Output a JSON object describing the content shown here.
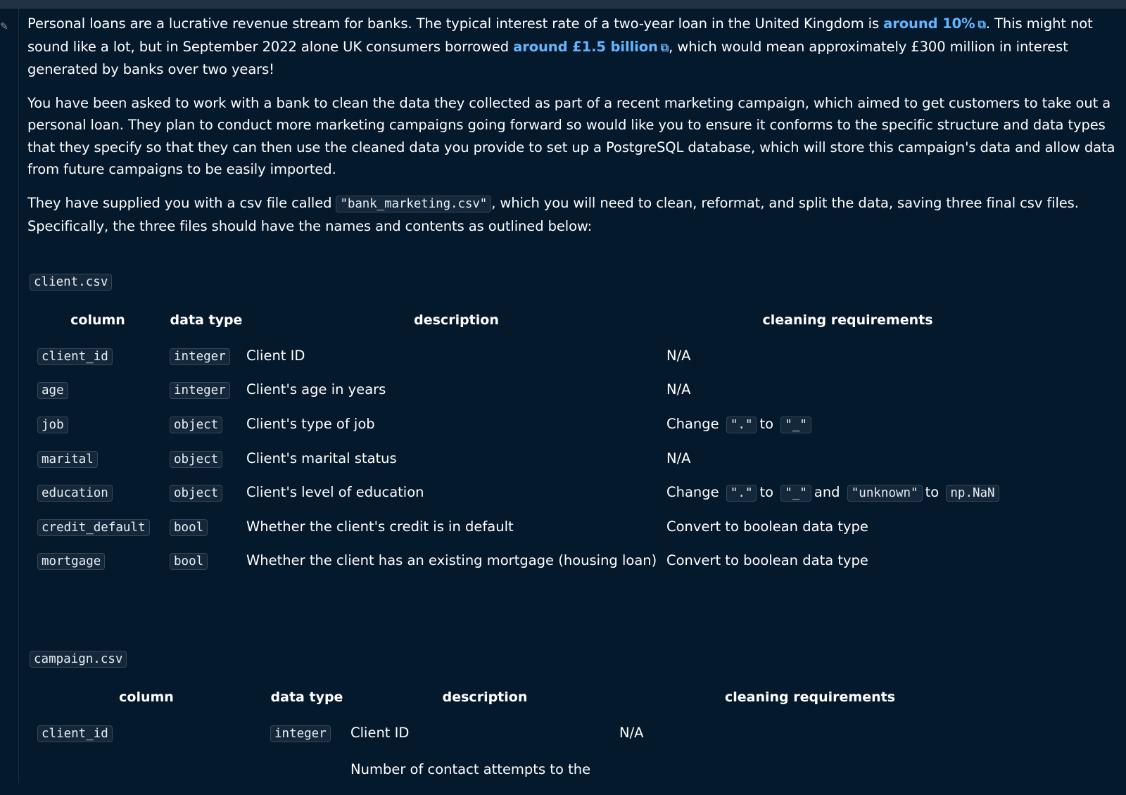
{
  "intro": {
    "p1_a": "Personal loans are a lucrative revenue stream for banks. The typical interest rate of a two-year loan in the United Kingdom is ",
    "p1_link1": "around 10%",
    "p1_b": ". This might not sound like a lot, but in September 2022 alone UK consumers borrowed ",
    "p1_link2": "around £1.5 billion",
    "p1_c": ", which would mean approximately £300 million in interest generated by banks over two years!",
    "p2": "You have been asked to work with a bank to clean the data they collected as part of a recent marketing campaign, which aimed to get customers to take out a personal loan. They plan to conduct more marketing campaigns going forward so would like you to ensure it conforms to the specific structure and data types that they specify so that they can then use the cleaned data you provide to set up a PostgreSQL database, which will store this campaign's data and allow data from future campaigns to be easily imported.",
    "p3_a": "They have supplied you with a csv file called ",
    "p3_code": "\"bank_marketing.csv\"",
    "p3_b": ", which you will need to clean, reformat, and split the data, saving three final csv files. Specifically, the three files should have the names and contents as outlined below:"
  },
  "headers": {
    "column": "column",
    "data_type": "data type",
    "description": "description",
    "cleaning": "cleaning requirements"
  },
  "client": {
    "file": "client.csv",
    "rows": [
      {
        "column": "client_id",
        "type": "integer",
        "description": "Client ID",
        "cleaning": "N/A"
      },
      {
        "column": "age",
        "type": "integer",
        "description": "Client's age in years",
        "cleaning": "N/A"
      },
      {
        "column": "job",
        "type": "object",
        "description": "Client's type of job",
        "c_change": "Change",
        "c_from": "\".\"",
        "c_to": "to",
        "c_target": "\"_\""
      },
      {
        "column": "marital",
        "type": "object",
        "description": "Client's marital status",
        "cleaning": "N/A"
      },
      {
        "column": "education",
        "type": "object",
        "description": "Client's level of education",
        "c_change": "Change",
        "c_from": "\".\"",
        "c_to": "to",
        "c_target": "\"_\"",
        "c_and": "and",
        "c_from2": "\"unknown\"",
        "c_to2": "to",
        "c_target2": "np.NaN"
      },
      {
        "column": "credit_default",
        "type": "bool",
        "description": "Whether the client's credit is in default",
        "cleaning": "Convert to boolean data type"
      },
      {
        "column": "mortgage",
        "type": "bool",
        "description": "Whether the client has an existing mortgage (housing loan)",
        "cleaning": "Convert to boolean data type"
      }
    ]
  },
  "campaign": {
    "file": "campaign.csv",
    "rows": [
      {
        "column": "client_id",
        "type": "integer",
        "description": "Client ID",
        "cleaning": "N/A"
      },
      {
        "description": "Number of contact attempts to the"
      }
    ]
  },
  "icons": {
    "gutter": "edit-pen-icon",
    "external": "external-link-icon"
  },
  "colors": {
    "background": "#05192d",
    "link": "#65b6ff",
    "code_bg": "#15283b"
  }
}
